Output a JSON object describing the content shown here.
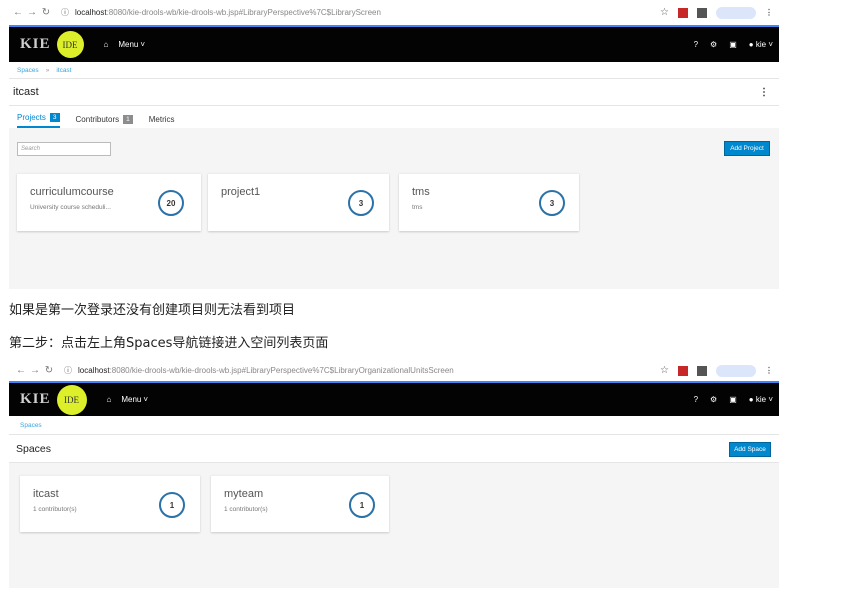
{
  "shot1": {
    "url_host": "localhost",
    "url_path": ":8080/kie-drools-wb/kie-drools-wb.jsp#LibraryPerspective%7C$LibraryScreen",
    "brand_kie": "KIE",
    "brand_ide": "IDE",
    "menu_label": "Menu",
    "user_label": "kie",
    "breadcrumb": [
      "Spaces",
      "itcast"
    ],
    "page_title": "itcast",
    "tabs": [
      {
        "label": "Projects",
        "count": "3"
      },
      {
        "label": "Contributors",
        "count": "1"
      },
      {
        "label": "Metrics"
      }
    ],
    "search_placeholder": "Search",
    "add_button": "Add Project",
    "cards": [
      {
        "name": "curriculumcourse",
        "desc": "University course scheduli...",
        "count": "20"
      },
      {
        "name": "project1",
        "desc": "",
        "count": "3"
      },
      {
        "name": "tms",
        "desc": "tms",
        "count": "3"
      }
    ]
  },
  "captions": [
    "如果是第一次登录还没有创建项目则无法看到项目",
    "第二步：点击左上角Spaces导航链接进入空间列表页面"
  ],
  "shot2": {
    "url_host": "localhost",
    "url_path": ":8080/kie-drools-wb/kie-drools-wb.jsp#LibraryPerspective%7C$LibraryOrganizationalUnitsScreen",
    "brand_kie": "KIE",
    "brand_ide": "IDE",
    "menu_label": "Menu",
    "user_label": "kie",
    "breadcrumb": [
      "Spaces"
    ],
    "page_title": "Spaces",
    "add_button": "Add Space",
    "cards": [
      {
        "name": "itcast",
        "desc": "1 contributor(s)",
        "count": "1"
      },
      {
        "name": "myteam",
        "desc": "1 contributor(s)",
        "count": "1"
      }
    ]
  },
  "colors": {
    "accent": "#0088ce",
    "topbar": "#030303",
    "ide_logo": "#dcef2a"
  }
}
